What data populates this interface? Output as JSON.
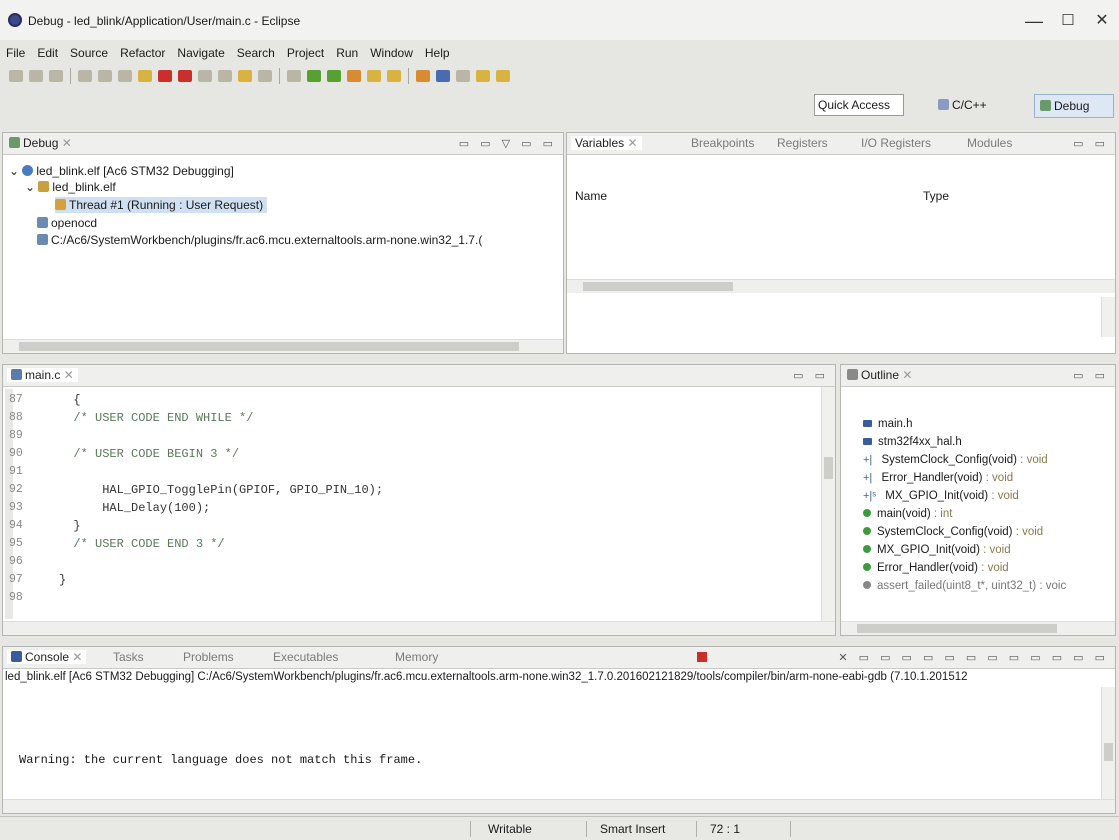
{
  "window": {
    "title": "Debug - led_blink/Application/User/main.c - Eclipse",
    "minimize": "—",
    "maximize": "☐",
    "close": "✕"
  },
  "menubar": [
    "File",
    "Edit",
    "Source",
    "Refactor",
    "Navigate",
    "Search",
    "Project",
    "Run",
    "Window",
    "Help"
  ],
  "perspectives": {
    "quick_access": "Quick Access",
    "cc": "C/C++",
    "debug": "Debug"
  },
  "debug_view": {
    "tab": "Debug",
    "tree": [
      {
        "label": "led_blink.elf [Ac6 STM32 Debugging]"
      },
      {
        "label": "led_blink.elf"
      },
      {
        "label": "Thread #1 (Running : User Request)"
      },
      {
        "label": "openocd"
      },
      {
        "label": "C:/Ac6/SystemWorkbench/plugins/fr.ac6.mcu.externaltools.arm-none.win32_1.7.("
      }
    ]
  },
  "variables_view": {
    "tabs": [
      "Variables",
      "Breakpoints",
      "Registers",
      "I/O Registers",
      "Modules"
    ],
    "columns": [
      "Name",
      "Type"
    ]
  },
  "editor": {
    "tab": "main.c",
    "lines": [
      {
        "n": "87",
        "code": "  {"
      },
      {
        "n": "88",
        "code": "  /* USER CODE END WHILE */"
      },
      {
        "n": "89",
        "code": ""
      },
      {
        "n": "90",
        "code": "  /* USER CODE BEGIN 3 */"
      },
      {
        "n": "91",
        "code": ""
      },
      {
        "n": "92",
        "code": "      HAL_GPIO_TogglePin(GPIOF, GPIO_PIN_10);"
      },
      {
        "n": "93",
        "code": "      HAL_Delay(100);"
      },
      {
        "n": "94",
        "code": "  }"
      },
      {
        "n": "95",
        "code": "  /* USER CODE END 3 */"
      },
      {
        "n": "96",
        "code": ""
      },
      {
        "n": "97",
        "code": "}"
      },
      {
        "n": "98",
        "code": ""
      }
    ]
  },
  "outline": {
    "tab": "Outline",
    "items": [
      {
        "name": "main.h",
        "type": "",
        "kind": "include"
      },
      {
        "name": "stm32f4xx_hal.h",
        "type": "",
        "kind": "include"
      },
      {
        "name": "SystemClock_Config(void)",
        "type": " : void",
        "kind": "decl"
      },
      {
        "name": "Error_Handler(void)",
        "type": " : void",
        "kind": "decl"
      },
      {
        "name": "MX_GPIO_Init(void)",
        "type": " : void",
        "kind": "decl-static"
      },
      {
        "name": "main(void)",
        "type": " : int",
        "kind": "func"
      },
      {
        "name": "SystemClock_Config(void)",
        "type": " : void",
        "kind": "func"
      },
      {
        "name": "MX_GPIO_Init(void)",
        "type": " : void",
        "kind": "func-static"
      },
      {
        "name": "Error_Handler(void)",
        "type": " : void",
        "kind": "func"
      },
      {
        "name": "assert_failed(uint8_t*, uint32_t) : voic",
        "type": "",
        "kind": "func-gray"
      }
    ]
  },
  "console": {
    "tabs": [
      "Console",
      "Tasks",
      "Problems",
      "Executables",
      "Memory"
    ],
    "header": "led_blink.elf [Ac6 STM32 Debugging] C:/Ac6/SystemWorkbench/plugins/fr.ac6.mcu.externaltools.arm-none.win32_1.7.0.201602121829/tools/compiler/bin/arm-none-eabi-gdb (7.10.1.201512",
    "output": "Warning: the current language does not match this frame."
  },
  "status": {
    "writable": "Writable",
    "insert": "Smart Insert",
    "position": "72 : 1"
  }
}
